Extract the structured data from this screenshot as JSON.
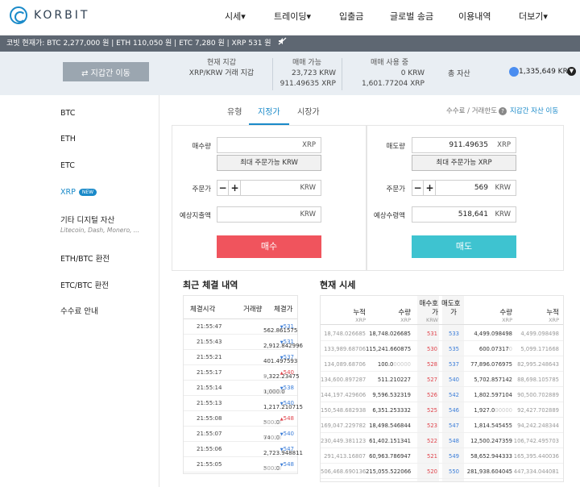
{
  "brand": "KORBIT",
  "nav": [
    {
      "label": "시세▾"
    },
    {
      "label": "트레이딩▾"
    },
    {
      "label": "입출금"
    },
    {
      "label": "글로벌 송금"
    },
    {
      "label": "이용내역"
    },
    {
      "label": "더보기▾"
    }
  ],
  "ticker": "코빗 현재가: BTC 2,277,000 원 | ETH 110,050 원 | ETC 7,280 원 | XRP 531 원",
  "summary": {
    "wallet_button": "⇄ 지갑간 이동",
    "wallet_label": "현재 지갑",
    "wallet_name": "XRP/KRW 거래 지갑",
    "available_label": "매매 가능",
    "available_krw": "23,723 KRW",
    "available_xrp_int": "911.49635",
    "available_xrp_unit": "XRP",
    "inuse_label": "매매 사용 중",
    "inuse_krw": "0 KRW",
    "inuse_xrp_int": "1,601.77204",
    "inuse_xrp_unit": "XRP",
    "total_label": "총 자산",
    "total_value": "1,335,649 KRW"
  },
  "sidebar": {
    "items": [
      {
        "label": "BTC"
      },
      {
        "label": "ETH"
      },
      {
        "label": "ETC"
      },
      {
        "label": "XRP"
      },
      {
        "label": "기타 디지털 자산"
      },
      {
        "label": "ETH/BTC 환전"
      },
      {
        "label": "ETC/BTC 환전"
      },
      {
        "label": "수수료 안내"
      }
    ],
    "new_badge": "NEW",
    "other_sub": "Litecoin, Dash, Monero, ..."
  },
  "tabs": [
    {
      "label": "유형"
    },
    {
      "label": "지정가"
    },
    {
      "label": "시장가"
    }
  ],
  "fee_text": "수수료 / 거래한도",
  "fee_help": "?",
  "wallet_link": "지갑간 자산 이동",
  "buy": {
    "qty_label": "매수량",
    "qty_unit": "XRP",
    "qty_value": "",
    "max_btn": "최대 주문가능 KRW",
    "price_label": "주문가",
    "price_unit": "KRW",
    "price_value": "",
    "expected_label": "예상지출액",
    "expected_unit": "KRW",
    "expected_value": "",
    "submit": "매수"
  },
  "sell": {
    "qty_label": "매도량",
    "qty_unit": "XRP",
    "qty_value": "911.49635",
    "max_btn": "최대 주문가능 XRP",
    "price_label": "주문가",
    "price_unit": "KRW",
    "price_value": "569",
    "expected_label": "예상수령액",
    "expected_unit": "KRW",
    "expected_value": "518,641",
    "submit": "매도"
  },
  "stepper_minus": "−",
  "stepper_plus": "+",
  "trades": {
    "title": "최근 체결 내역",
    "headers": [
      "체결시각",
      "거래량",
      "체결가"
    ],
    "rows": [
      {
        "time": "21:55:47",
        "qty": "562.861575",
        "qty_zero": "",
        "price": "531",
        "dir": "down"
      },
      {
        "time": "21:55:43",
        "qty": "2,912.842996",
        "qty_zero": "",
        "price": "531",
        "dir": "down"
      },
      {
        "time": "21:55:21",
        "qty": "401.497593",
        "qty_zero": "",
        "price": "537",
        "dir": "down"
      },
      {
        "time": "21:55:17",
        "qty": "9,322.23475",
        "qty_zero": "0",
        "price": "540",
        "dir": "up"
      },
      {
        "time": "21:55:14",
        "qty": "1,000.0",
        "qty_zero": "00000",
        "price": "538",
        "dir": "down"
      },
      {
        "time": "21:55:13",
        "qty": "1,217.210715",
        "qty_zero": "",
        "price": "540",
        "dir": "down"
      },
      {
        "time": "21:55:08",
        "qty": "500.0",
        "qty_zero": "00000",
        "price": "548",
        "dir": "up"
      },
      {
        "time": "21:55:07",
        "qty": "740.0",
        "qty_zero": "00000",
        "price": "540",
        "dir": "down"
      },
      {
        "time": "21:55:06",
        "qty": "2,723.948811",
        "qty_zero": "",
        "price": "547",
        "dir": "down"
      },
      {
        "time": "21:55:05",
        "qty": "500.0",
        "qty_zero": "00000",
        "price": "548",
        "dir": "down"
      }
    ]
  },
  "book": {
    "title": "현재 시세",
    "headers": {
      "ask_cum": "누적",
      "ask_cum_unit": "XRP",
      "ask_qty": "수량",
      "ask_qty_unit": "XRP",
      "ask_price_1": "매수호",
      "ask_price_2": "가",
      "ask_price_unit": "KRW",
      "bid_price_1": "매도호",
      "bid_price_2": "가",
      "bid_qty": "수량",
      "bid_qty_unit": "XRP",
      "bid_cum": "누적",
      "bid_cum_unit": "XRP"
    },
    "rows": [
      {
        "ask_cum": "18,748.026685",
        "ask_qty": "18,748.026685",
        "ask_qty_zero": "",
        "ask_price": "531",
        "bid_price": "533",
        "bid_qty": "4,499.098498",
        "bid_qty_zero": "",
        "bid_cum": "4,499.098498"
      },
      {
        "ask_cum": "133,989.68706",
        "ask_qty": "115,241.660875",
        "ask_qty_zero": "",
        "ask_price": "530",
        "bid_price": "535",
        "bid_qty": "600.07317",
        "bid_qty_zero": "0",
        "bid_cum": "5,099.171668"
      },
      {
        "ask_cum": "134,089.68706",
        "ask_qty": "100.0",
        "ask_qty_zero": "00000",
        "ask_price": "528",
        "bid_price": "537",
        "bid_qty": "77,896.076975",
        "bid_qty_zero": "",
        "bid_cum": "82,995.248643"
      },
      {
        "ask_cum": "134,600.897287",
        "ask_qty": "511.210227",
        "ask_qty_zero": "",
        "ask_price": "527",
        "bid_price": "540",
        "bid_qty": "5,702.857142",
        "bid_qty_zero": "",
        "bid_cum": "88,698.105785"
      },
      {
        "ask_cum": "144,197.429606",
        "ask_qty": "9,596.532319",
        "ask_qty_zero": "",
        "ask_price": "526",
        "bid_price": "542",
        "bid_qty": "1,802.597104",
        "bid_qty_zero": "",
        "bid_cum": "90,500.702889"
      },
      {
        "ask_cum": "150,548.682938",
        "ask_qty": "6,351.253332",
        "ask_qty_zero": "",
        "ask_price": "525",
        "bid_price": "546",
        "bid_qty": "1,927.0",
        "bid_qty_zero": "00000",
        "bid_cum": "92,427.702889"
      },
      {
        "ask_cum": "169,047.229782",
        "ask_qty": "18,498.546844",
        "ask_qty_zero": "",
        "ask_price": "523",
        "bid_price": "547",
        "bid_qty": "1,814.545455",
        "bid_qty_zero": "",
        "bid_cum": "94,242.248344"
      },
      {
        "ask_cum": "230,449.381123",
        "ask_qty": "61,402.151341",
        "ask_qty_zero": "",
        "ask_price": "522",
        "bid_price": "548",
        "bid_qty": "12,500.247359",
        "bid_qty_zero": "",
        "bid_cum": "106,742.495703"
      },
      {
        "ask_cum": "291,413.16807",
        "ask_qty": "60,963.786947",
        "ask_qty_zero": "",
        "ask_price": "521",
        "bid_price": "549",
        "bid_qty": "58,652.944333",
        "bid_qty_zero": "",
        "bid_cum": "165,395.440036"
      },
      {
        "ask_cum": "506,468.690136",
        "ask_qty": "215,055.522066",
        "ask_qty_zero": "",
        "ask_price": "520",
        "bid_price": "550",
        "bid_qty": "281,938.604045",
        "bid_qty_zero": "",
        "bid_cum": "447,334.044081"
      }
    ]
  },
  "colors": {
    "accent": "#1a8ac9",
    "buy": "#f0545d",
    "sell": "#3ec3d0",
    "ticker_bg": "#5e6772",
    "summary_bg": "#e9eef3"
  }
}
